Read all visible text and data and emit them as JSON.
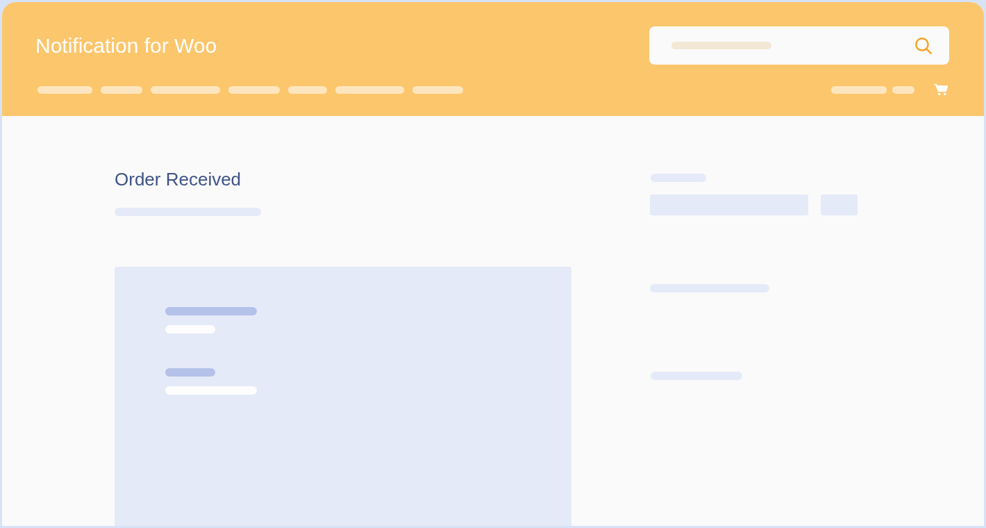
{
  "header": {
    "title": "Notification for Woo"
  },
  "page": {
    "heading": "Order Received"
  }
}
